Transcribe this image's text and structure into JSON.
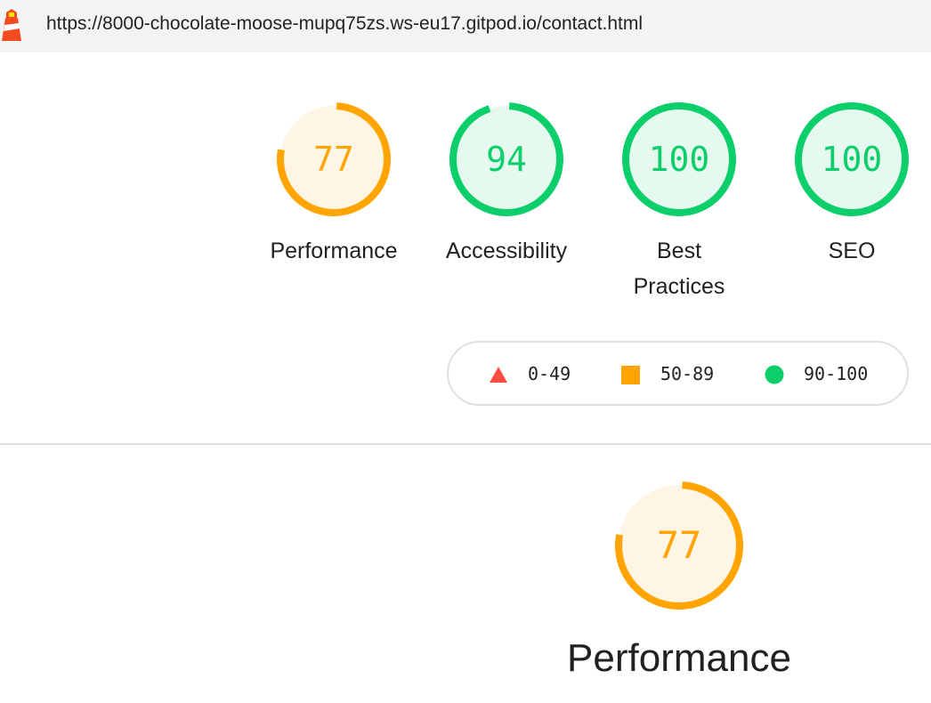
{
  "header": {
    "url": "https://8000-chocolate-moose-mupq75zs.ws-eu17.gitpod.io/contact.html",
    "logo_icon": "lighthouse-icon"
  },
  "colors": {
    "pass": "#0cce6b",
    "pass_bg": "#e6f9ef",
    "average": "#ffa400",
    "average_bg": "#fff5e5",
    "fail": "#ff4e42"
  },
  "scores": [
    {
      "label": "Performance",
      "value": "77",
      "status": "average"
    },
    {
      "label": "Accessibility",
      "value": "94",
      "status": "pass"
    },
    {
      "label": "Best Practices",
      "value": "100",
      "status": "pass"
    },
    {
      "label": "SEO",
      "value": "100",
      "status": "pass"
    }
  ],
  "legend": [
    {
      "icon": "triangle-icon",
      "range": "0-49",
      "status": "fail"
    },
    {
      "icon": "square-icon",
      "range": "50-89",
      "status": "average"
    },
    {
      "icon": "circle-icon",
      "range": "90-100",
      "status": "pass"
    }
  ],
  "category": {
    "label": "Performance",
    "value": "77",
    "status": "average"
  }
}
